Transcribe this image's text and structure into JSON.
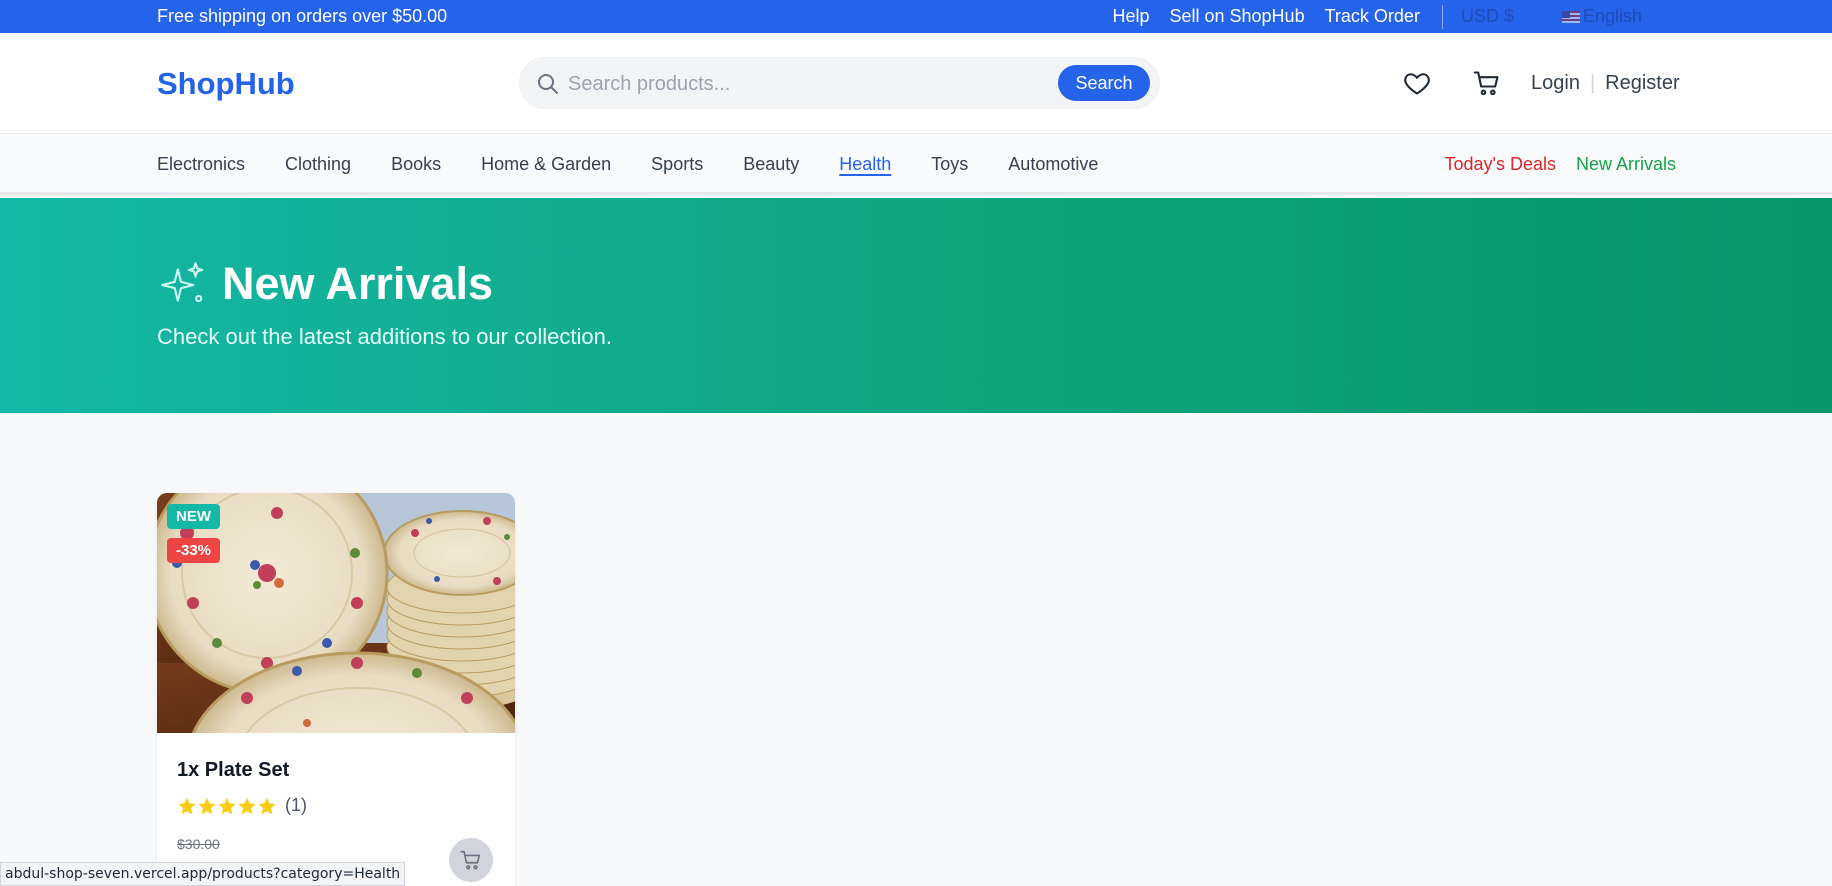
{
  "topbar": {
    "promo": "Free shipping on orders over $50.00",
    "links": [
      "Help",
      "Sell on ShopHub",
      "Track Order"
    ],
    "currency": "USD $",
    "language": "English"
  },
  "header": {
    "logo": "ShopHub",
    "search_placeholder": "Search products...",
    "search_button": "Search",
    "login": "Login",
    "separator": "|",
    "register": "Register"
  },
  "categories": {
    "items": [
      "Electronics",
      "Clothing",
      "Books",
      "Home & Garden",
      "Sports",
      "Beauty",
      "Health",
      "Toys",
      "Automotive"
    ],
    "active": "Health",
    "todays_deals": "Today's Deals",
    "new_arrivals": "New Arrivals"
  },
  "hero": {
    "title": "New Arrivals",
    "subtitle": "Check out the latest additions to our collection."
  },
  "products": [
    {
      "name": "1x Plate Set",
      "badge_new": "NEW",
      "badge_discount": "-33%",
      "rating_stars": 5,
      "review_count": "(1)",
      "original_price": "$30.00"
    }
  ],
  "statusbar": {
    "url": "abdul-shop-seven.vercel.app/products?category=Health"
  },
  "colors": {
    "primary": "#2563eb",
    "hero_start": "#14b8a6",
    "hero_end": "#059669",
    "deals": "#dc2626",
    "arrivals": "#16a34a",
    "star": "#facc15"
  },
  "icons": [
    "search-icon",
    "heart-icon",
    "cart-icon",
    "sparkles-icon",
    "star-icon",
    "us-flag-icon"
  ]
}
